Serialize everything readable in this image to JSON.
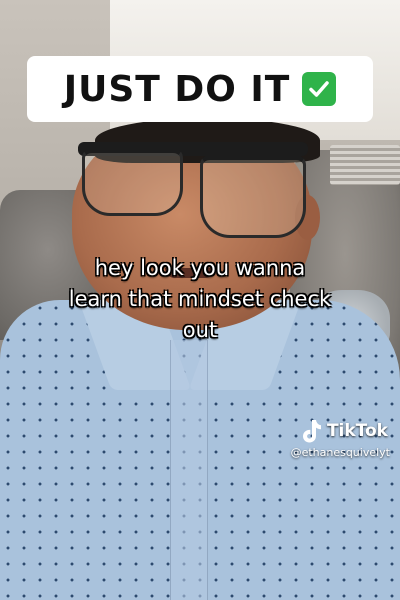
{
  "overlay": {
    "title": "JUST DO IT",
    "title_emoji": "check-mark-button-icon",
    "caption_lines": [
      "hey look you wanna",
      "learn that mindset check",
      "out"
    ]
  },
  "watermark": {
    "brand": "TikTok",
    "handle": "@ethanesquivelyt",
    "logo_icon": "tiktok-note-icon"
  },
  "colors": {
    "banner_bg": "#ffffff",
    "title_text": "#111111",
    "check_green": "#2fb34a",
    "caption_text": "#ffffff",
    "caption_outline": "#000000"
  }
}
